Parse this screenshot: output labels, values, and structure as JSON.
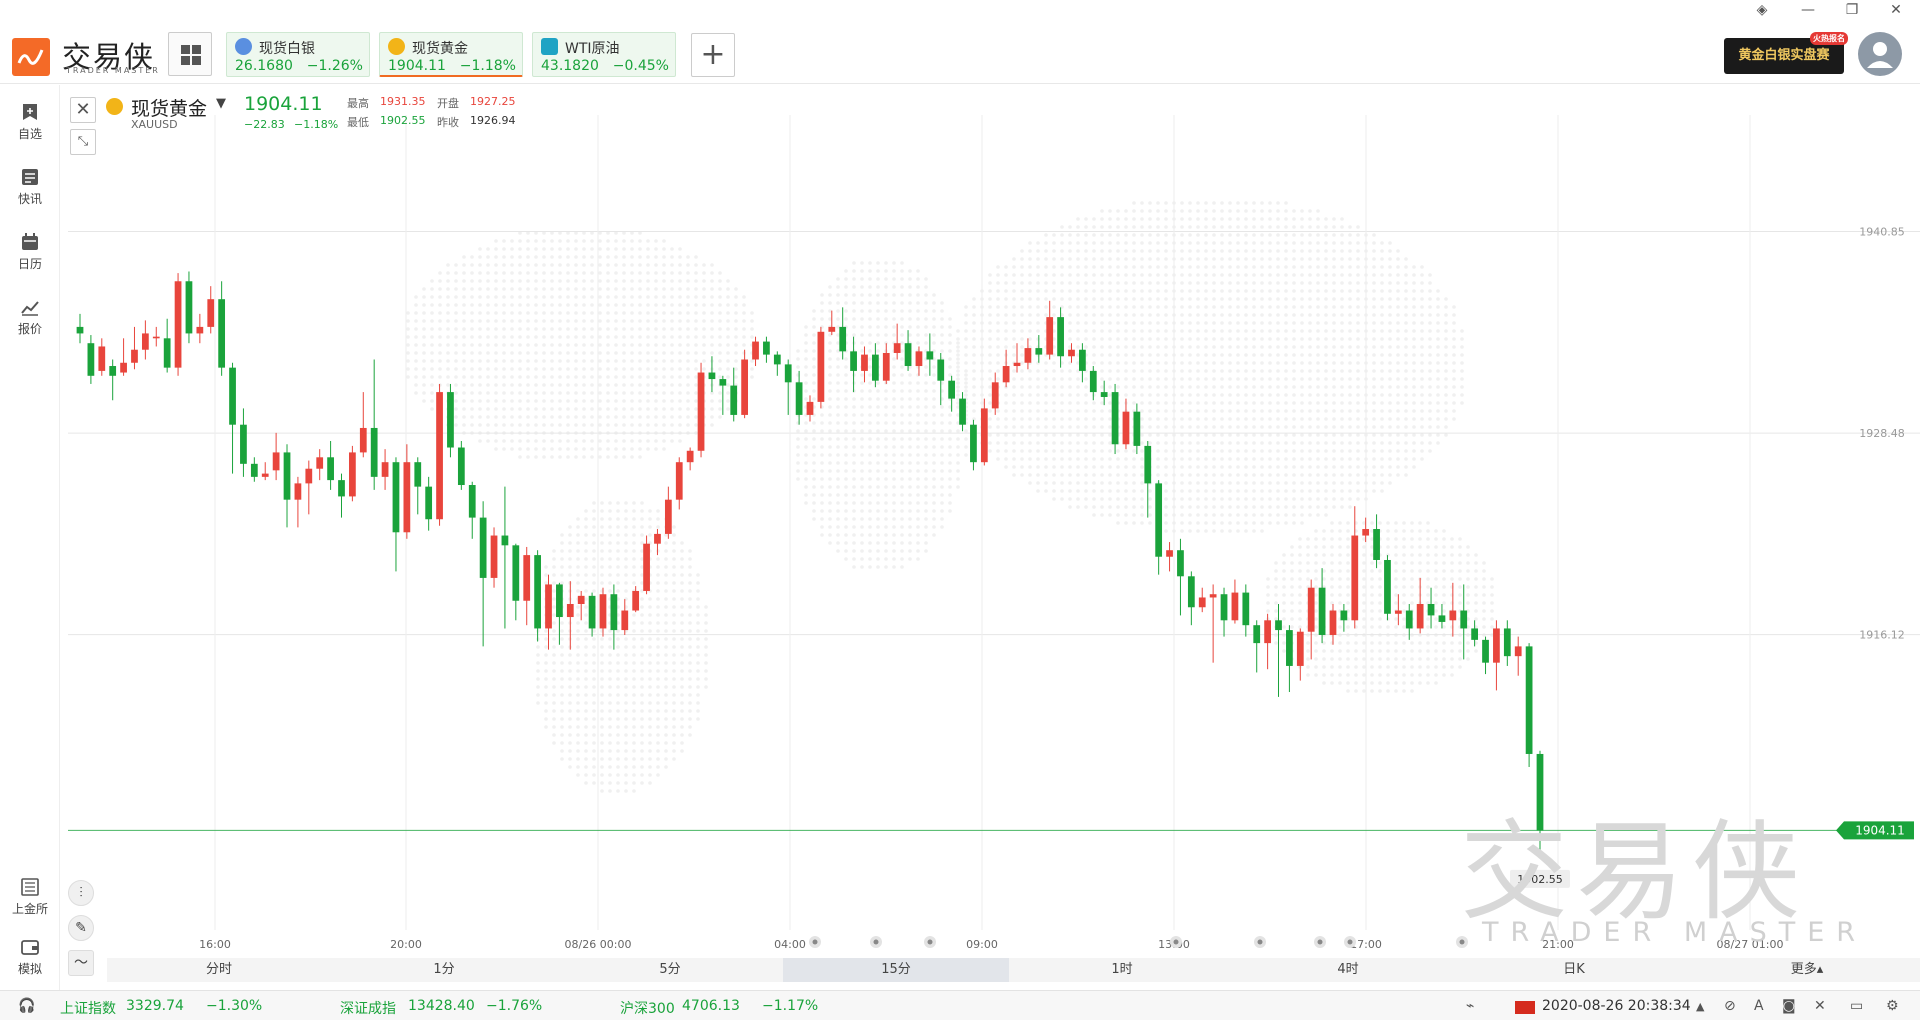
{
  "app": {
    "logo_text": "交易侠",
    "logo_sub": "TRADER MASTER"
  },
  "tickers": [
    {
      "name": "现货白银",
      "price": "26.1680",
      "pct": "−1.26%",
      "icon": "silver-coin-icon",
      "icon_color": "#5a8fe0"
    },
    {
      "name": "现货黄金",
      "price": "1904.11",
      "pct": "−1.18%",
      "icon": "gold-coin-icon",
      "icon_color": "#f2b418"
    },
    {
      "name": "WTI原油",
      "price": "43.1820",
      "pct": "−0.45%",
      "icon": "oil-drop-icon",
      "icon_color": "#1fa3c4"
    }
  ],
  "promo": {
    "label": "黄金白银实盘赛",
    "badge": "火热报名"
  },
  "sidebar": [
    {
      "label": "自选",
      "icon": "bookmark-add-icon"
    },
    {
      "label": "快讯",
      "icon": "news-icon"
    },
    {
      "label": "日历",
      "icon": "calendar-icon"
    },
    {
      "label": "报价",
      "icon": "quote-line-icon"
    },
    {
      "label": "上金所",
      "icon": "exchange-icon"
    },
    {
      "label": "模拟",
      "icon": "wallet-icon"
    }
  ],
  "symbol": {
    "name": "现货黄金",
    "code": "XAUUSD",
    "price": "1904.11",
    "change": "−22.83",
    "pct": "−1.18%",
    "high_label": "最高",
    "high": "1931.35",
    "open_label": "开盘",
    "open": "1927.25",
    "low_label": "最低",
    "low": "1902.55",
    "prev_label": "昨收",
    "prev": "1926.94"
  },
  "periods": [
    "分时",
    "1分",
    "5分",
    "15分",
    "1时",
    "4时",
    "日K"
  ],
  "active_period": "15分",
  "more_label": "更多▴",
  "watermark": {
    "main": "交易侠",
    "sub": "TRADER MASTER"
  },
  "status": {
    "items": [
      {
        "name": "上证指数",
        "value": "3329.74",
        "pct": "−1.30%"
      },
      {
        "name": "深证成指",
        "value": "13428.40",
        "pct": "−1.76%"
      },
      {
        "name": "沪深300",
        "value": "4706.13",
        "pct": "−1.17%"
      }
    ],
    "datetime": "2020-08-26 20:38:34"
  },
  "colors": {
    "up": "#e8453c",
    "down": "#1aa33b",
    "accent": "#f06b22"
  },
  "chart_data": {
    "type": "candlestick",
    "y_ticks": [
      1940.85,
      1928.48,
      1916.12
    ],
    "ylim": [
      1898.0,
      1948.0
    ],
    "last_price": "1904.11",
    "low_marker": "1902.55",
    "x_tick_labels": [
      "16:00",
      "20:00",
      "08/26 00:00",
      "04:00",
      "09:00",
      "13:00",
      "17:00",
      "21:00",
      "08/27 01:00"
    ],
    "candles": [
      [
        1935.0,
        1934.6,
        1935.8,
        1934.0
      ],
      [
        1934.0,
        1932.0,
        1934.5,
        1931.5
      ],
      [
        1932.3,
        1933.8,
        1934.3,
        1932.0
      ],
      [
        1932.6,
        1932.0,
        1933.0,
        1930.5
      ],
      [
        1932.2,
        1932.8,
        1934.3,
        1932.0
      ],
      [
        1932.8,
        1933.6,
        1935.0,
        1932.4
      ],
      [
        1933.6,
        1934.6,
        1935.4,
        1933.0
      ],
      [
        1934.3,
        1934.4,
        1935.0,
        1933.8
      ],
      [
        1934.3,
        1932.5,
        1935.5,
        1932.2
      ],
      [
        1932.5,
        1937.8,
        1938.3,
        1932.0
      ],
      [
        1937.8,
        1934.6,
        1938.4,
        1934.0
      ],
      [
        1934.6,
        1935.0,
        1935.8,
        1934.0
      ],
      [
        1935.0,
        1936.7,
        1937.5,
        1934.6
      ],
      [
        1936.7,
        1932.5,
        1937.8,
        1932.0
      ],
      [
        1932.5,
        1929.0,
        1932.8,
        1926.0
      ],
      [
        1929.0,
        1926.6,
        1930.0,
        1925.8
      ],
      [
        1926.6,
        1925.8,
        1927.0,
        1925.5
      ],
      [
        1925.8,
        1926.0,
        1926.7,
        1925.6
      ],
      [
        1926.2,
        1927.3,
        1928.5,
        1925.6
      ],
      [
        1927.3,
        1924.4,
        1927.8,
        1922.7
      ],
      [
        1924.4,
        1925.4,
        1925.8,
        1922.7
      ],
      [
        1925.4,
        1926.3,
        1926.8,
        1923.5
      ],
      [
        1926.3,
        1927.0,
        1927.5,
        1925.6
      ],
      [
        1927.0,
        1925.6,
        1928.0,
        1925.0
      ],
      [
        1925.6,
        1924.6,
        1926.0,
        1923.3
      ],
      [
        1924.6,
        1927.3,
        1927.7,
        1924.3
      ],
      [
        1927.3,
        1928.8,
        1931.0,
        1927.0
      ],
      [
        1928.8,
        1925.8,
        1933.0,
        1925.0
      ],
      [
        1925.8,
        1926.7,
        1927.5,
        1925.0
      ],
      [
        1926.7,
        1922.4,
        1927.0,
        1920.0
      ],
      [
        1922.4,
        1926.7,
        1927.8,
        1922.0
      ],
      [
        1926.7,
        1925.2,
        1927.0,
        1923.5
      ],
      [
        1925.2,
        1923.2,
        1925.8,
        1922.5
      ],
      [
        1923.2,
        1931.0,
        1931.5,
        1922.8
      ],
      [
        1931.0,
        1927.6,
        1931.5,
        1927.0
      ],
      [
        1927.6,
        1925.3,
        1928.0,
        1925.0
      ],
      [
        1925.3,
        1923.3,
        1925.5,
        1922.0
      ],
      [
        1923.3,
        1919.6,
        1924.3,
        1915.4
      ],
      [
        1919.6,
        1922.2,
        1922.7,
        1919.0
      ],
      [
        1922.2,
        1921.6,
        1925.2,
        1916.5
      ],
      [
        1921.6,
        1918.2,
        1921.7,
        1917.0
      ],
      [
        1918.2,
        1921.0,
        1921.5,
        1916.7
      ],
      [
        1921.0,
        1916.5,
        1921.3,
        1915.7
      ],
      [
        1916.5,
        1919.2,
        1919.8,
        1915.2
      ],
      [
        1919.2,
        1917.2,
        1919.3,
        1915.5
      ],
      [
        1917.2,
        1918.0,
        1919.4,
        1915.2
      ],
      [
        1918.0,
        1918.5,
        1918.8,
        1917.0
      ],
      [
        1918.5,
        1916.5,
        1918.7,
        1916.0
      ],
      [
        1916.5,
        1918.6,
        1919.0,
        1916.0
      ],
      [
        1918.6,
        1916.4,
        1919.2,
        1915.2
      ],
      [
        1916.4,
        1917.6,
        1918.3,
        1916.1
      ],
      [
        1917.6,
        1918.8,
        1919.1,
        1917.5
      ],
      [
        1918.8,
        1921.7,
        1922.2,
        1918.6
      ],
      [
        1921.7,
        1922.3,
        1922.6,
        1921.0
      ],
      [
        1922.3,
        1924.4,
        1925.2,
        1922.0
      ],
      [
        1924.4,
        1926.7,
        1927.0,
        1923.8
      ],
      [
        1926.7,
        1927.4,
        1927.6,
        1926.2
      ],
      [
        1927.4,
        1932.2,
        1932.8,
        1927.0
      ],
      [
        1932.2,
        1931.8,
        1933.2,
        1931.0
      ],
      [
        1931.8,
        1931.4,
        1932.0,
        1929.6
      ],
      [
        1931.4,
        1929.6,
        1932.5,
        1929.2
      ],
      [
        1929.6,
        1933.0,
        1933.6,
        1929.4
      ],
      [
        1933.0,
        1934.1,
        1934.4,
        1932.6
      ],
      [
        1934.1,
        1933.3,
        1934.4,
        1932.8
      ],
      [
        1933.3,
        1932.7,
        1933.5,
        1932.0
      ],
      [
        1932.7,
        1931.6,
        1933.0,
        1929.6
      ],
      [
        1931.6,
        1929.6,
        1932.3,
        1929.0
      ],
      [
        1929.6,
        1930.4,
        1930.8,
        1929.2
      ],
      [
        1930.4,
        1934.7,
        1935.0,
        1930.0
      ],
      [
        1934.7,
        1935.0,
        1936.0,
        1934.5
      ],
      [
        1935.0,
        1933.5,
        1936.2,
        1933.0
      ],
      [
        1933.5,
        1932.3,
        1934.4,
        1931.0
      ],
      [
        1932.3,
        1933.3,
        1933.8,
        1931.6
      ],
      [
        1933.3,
        1931.7,
        1934.0,
        1931.3
      ],
      [
        1931.7,
        1933.4,
        1934.0,
        1931.5
      ],
      [
        1933.4,
        1934.0,
        1935.2,
        1933.0
      ],
      [
        1934.0,
        1932.6,
        1934.8,
        1932.3
      ],
      [
        1932.6,
        1933.5,
        1933.8,
        1932.0
      ],
      [
        1933.5,
        1933.0,
        1934.6,
        1932.0
      ],
      [
        1933.0,
        1931.7,
        1933.4,
        1930.2
      ],
      [
        1931.7,
        1930.6,
        1932.0,
        1929.8
      ],
      [
        1930.6,
        1929.0,
        1931.0,
        1928.6
      ],
      [
        1929.0,
        1926.7,
        1929.3,
        1926.2
      ],
      [
        1926.7,
        1930.0,
        1930.6,
        1926.5
      ],
      [
        1930.0,
        1931.6,
        1932.2,
        1929.6
      ],
      [
        1931.6,
        1932.6,
        1933.6,
        1931.3
      ],
      [
        1932.6,
        1932.8,
        1934.0,
        1932.2
      ],
      [
        1932.8,
        1933.7,
        1934.3,
        1932.4
      ],
      [
        1933.7,
        1933.3,
        1934.5,
        1932.8
      ],
      [
        1933.3,
        1935.6,
        1936.6,
        1933.0
      ],
      [
        1935.6,
        1933.2,
        1936.2,
        1932.5
      ],
      [
        1933.2,
        1933.6,
        1934.0,
        1932.8
      ],
      [
        1933.6,
        1932.3,
        1934.0,
        1931.6
      ],
      [
        1932.3,
        1931.0,
        1932.6,
        1930.5
      ],
      [
        1931.0,
        1930.7,
        1931.7,
        1930.2
      ],
      [
        1931.0,
        1927.8,
        1931.5,
        1927.2
      ],
      [
        1927.8,
        1929.8,
        1930.6,
        1927.5
      ],
      [
        1929.8,
        1927.7,
        1930.3,
        1927.2
      ],
      [
        1927.7,
        1925.4,
        1928.0,
        1923.3
      ],
      [
        1925.4,
        1920.9,
        1925.6,
        1919.8
      ],
      [
        1920.9,
        1921.3,
        1921.8,
        1920.0
      ],
      [
        1921.3,
        1919.7,
        1922.0,
        1917.3
      ],
      [
        1919.7,
        1917.8,
        1920.0,
        1916.7
      ],
      [
        1917.8,
        1918.4,
        1919.0,
        1917.5
      ],
      [
        1918.4,
        1918.6,
        1919.2,
        1914.4
      ],
      [
        1918.6,
        1917.0,
        1919.0,
        1916.0
      ],
      [
        1917.0,
        1918.7,
        1919.5,
        1916.8
      ],
      [
        1918.7,
        1916.7,
        1919.2,
        1916.0
      ],
      [
        1916.7,
        1915.6,
        1917.0,
        1913.8
      ],
      [
        1915.6,
        1917.0,
        1917.4,
        1914.0
      ],
      [
        1917.0,
        1916.4,
        1918.0,
        1912.3
      ],
      [
        1916.4,
        1914.2,
        1916.7,
        1912.6
      ],
      [
        1914.2,
        1916.3,
        1916.5,
        1913.3
      ],
      [
        1916.3,
        1919.0,
        1919.5,
        1914.6
      ],
      [
        1919.0,
        1916.1,
        1920.2,
        1915.6
      ],
      [
        1916.1,
        1917.6,
        1918.0,
        1915.5
      ],
      [
        1917.6,
        1917.0,
        1918.0,
        1916.3
      ],
      [
        1917.0,
        1922.2,
        1924.0,
        1916.5
      ],
      [
        1922.2,
        1922.6,
        1923.3,
        1921.8
      ],
      [
        1922.6,
        1920.7,
        1923.5,
        1920.2
      ],
      [
        1920.7,
        1917.4,
        1921.0,
        1917.0
      ],
      [
        1917.4,
        1917.6,
        1918.6,
        1916.7
      ],
      [
        1917.6,
        1916.5,
        1918.0,
        1915.8
      ],
      [
        1916.5,
        1918.0,
        1919.6,
        1916.2
      ],
      [
        1918.0,
        1917.3,
        1919.0,
        1916.5
      ],
      [
        1917.3,
        1916.9,
        1918.0,
        1916.5
      ],
      [
        1917.0,
        1917.6,
        1919.3,
        1916.0
      ],
      [
        1917.6,
        1916.5,
        1919.2,
        1914.6
      ],
      [
        1916.5,
        1915.8,
        1917.0,
        1915.4
      ],
      [
        1915.8,
        1914.4,
        1916.0,
        1913.7
      ],
      [
        1914.4,
        1916.5,
        1917.0,
        1912.7
      ],
      [
        1916.5,
        1914.8,
        1917.0,
        1914.2
      ],
      [
        1914.8,
        1915.4,
        1916.0,
        1913.6
      ],
      [
        1915.4,
        1908.8,
        1915.6,
        1908.0
      ],
      [
        1908.8,
        1904.1,
        1909.0,
        1902.55
      ]
    ]
  }
}
